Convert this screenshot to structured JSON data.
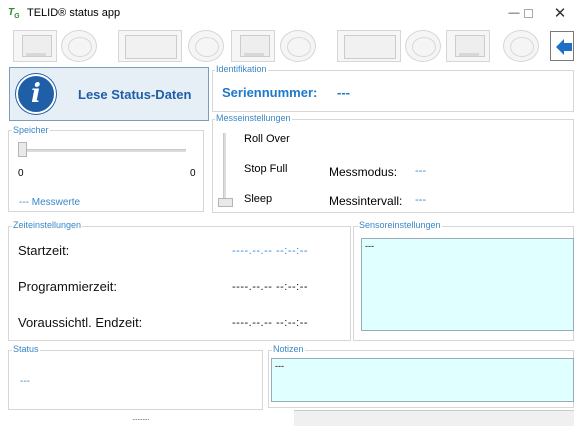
{
  "window": {
    "logo": "T",
    "logo_sub": "G",
    "title": "TELID® status app",
    "min_glyph": "—",
    "close_glyph": "✕"
  },
  "device_strip": {
    "icons": [
      "device-sensor",
      "device-round",
      "device-label",
      "device-round",
      "device-sensor",
      "device-round",
      "device-label",
      "device-round",
      "device-sensor",
      "device-round"
    ],
    "nav_icon": "arrow-left-icon"
  },
  "lese_button": {
    "label": "Lese Status-Daten",
    "icon_glyph": "i"
  },
  "identifikation": {
    "group_label": "Identifikation",
    "serial_label": "Seriennummer:",
    "serial_value": "---"
  },
  "speicher": {
    "group_label": "Speicher",
    "slider_min": "0",
    "slider_max": "0",
    "messwerte": "--- Messwerte"
  },
  "messeinstellungen": {
    "group_label": "Messeinstellungen",
    "modes": [
      "Roll Over",
      "Stop Full",
      "Sleep"
    ],
    "messmodus_label": "Messmodus:",
    "messmodus_value": "---",
    "messintervall_label": "Messintervall:",
    "messintervall_value": "---"
  },
  "zeiteinstellungen": {
    "group_label": "Zeiteinstellungen",
    "rows": [
      {
        "label": "Startzeit:",
        "value": "----.--.-- --:--:--"
      },
      {
        "label": "Programmierzeit:",
        "value": "----.--.-- --:--:--"
      },
      {
        "label": "Voraussichtl. Endzeit:",
        "value": "----.--.-- --:--:--"
      }
    ]
  },
  "sensoreinstellungen": {
    "group_label": "Sensoreinstellungen",
    "text": "---"
  },
  "status": {
    "group_label": "Status",
    "text": "---"
  },
  "notizen": {
    "group_label": "Notizen",
    "text": "---"
  },
  "colors": {
    "accent": "#1f78c8",
    "textarea_bg": "#e0ffff",
    "group_label": "#3a86c8"
  }
}
